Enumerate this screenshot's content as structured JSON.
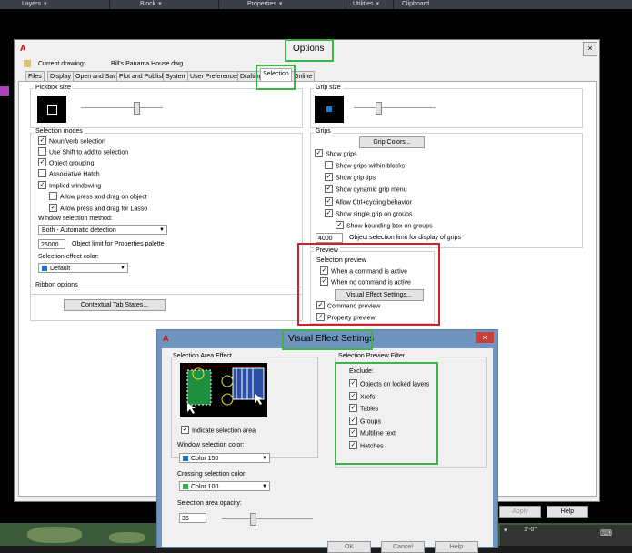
{
  "ribbon": {
    "panels": [
      "Layers",
      "Block",
      "Properties",
      "Utilities",
      "Clipboard"
    ]
  },
  "options": {
    "logo": "A",
    "title": "Options",
    "close_label": "×",
    "current_drawing_label": "Current drawing:",
    "current_drawing_value": "Bill's Panama House.dwg",
    "tabs": [
      "Files",
      "Display",
      "Open and Save",
      "Plot and Publish",
      "System",
      "User Preferences",
      "Drafting",
      "Selection",
      "Online"
    ],
    "active_tab": "Selection",
    "pickbox": {
      "label": "Pickbox size"
    },
    "grip_size": {
      "label": "Grip size"
    },
    "selection_modes": {
      "label": "Selection modes",
      "items": [
        {
          "label": "Noun/verb selection",
          "checked": true
        },
        {
          "label": "Use Shift to add to selection",
          "checked": false
        },
        {
          "label": "Object grouping",
          "checked": true
        },
        {
          "label": "Associative Hatch",
          "checked": false
        },
        {
          "label": "Implied windowing",
          "checked": true
        },
        {
          "label": "Allow press and drag on object",
          "checked": false
        },
        {
          "label": "Allow press and drag for Lasso",
          "checked": true
        }
      ],
      "window_method_label": "Window selection method:",
      "window_method_value": "Both - Automatic detection",
      "object_limit_value": "25000",
      "object_limit_label": "Object limit for Properties palette",
      "effect_color_label": "Selection effect color:",
      "effect_color_value": "Default",
      "effect_color_hex": "#1f6fd8"
    },
    "ribbon_options": {
      "label": "Ribbon options",
      "button": "Contextual Tab States..."
    },
    "grips": {
      "label": "Grips",
      "grip_colors_button": "Grip Colors...",
      "items": [
        {
          "label": "Show grips",
          "checked": true
        },
        {
          "label": "Show grips within blocks",
          "checked": false
        },
        {
          "label": "Show grip tips",
          "checked": true
        },
        {
          "label": "Show dynamic grip menu",
          "checked": true
        },
        {
          "label": "Allow Ctrl+cycling behavior",
          "checked": true
        },
        {
          "label": "Show single grip on groups",
          "checked": true
        },
        {
          "label": "Show bounding box on groups",
          "checked": true
        }
      ],
      "limit_value": "4000",
      "limit_label": "Object selection limit for display of grips"
    },
    "preview": {
      "label": "Preview",
      "selection_preview_label": "Selection preview",
      "when_active": {
        "label": "When a command is active",
        "checked": true
      },
      "when_none": {
        "label": "When no command is active",
        "checked": true
      },
      "ves_button": "Visual Effect Settings...",
      "command_preview": {
        "label": "Command preview",
        "checked": true
      },
      "property_preview": {
        "label": "Property preview",
        "checked": true
      }
    },
    "apply_button": "Apply",
    "help_button": "Help"
  },
  "ves": {
    "title": "Visual Effect Settings",
    "logo": "A",
    "close_label": "×",
    "area_effect_label": "Selection Area Effect",
    "indicate_area": {
      "label": "Indicate selection area",
      "checked": true
    },
    "window_color_label": "Window selection color:",
    "window_color_value": "Color 150",
    "window_color_hex": "#1a6ecc",
    "crossing_color_label": "Crossing selection color:",
    "crossing_color_value": "Color 100",
    "crossing_color_hex": "#2fb34a",
    "opacity_label": "Selection area opacity:",
    "opacity_value": "35",
    "filter_label": "Selection Preview Filter",
    "exclude_label": "Exclude:",
    "filter_items": [
      {
        "label": "Objects on locked layers",
        "checked": true
      },
      {
        "label": "Xrefs",
        "checked": true
      },
      {
        "label": "Tables",
        "checked": true
      },
      {
        "label": "Groups",
        "checked": true
      },
      {
        "label": "Multiline text",
        "checked": true
      },
      {
        "label": "Hatches",
        "checked": true
      }
    ],
    "ok_button": "OK",
    "cancel_button": "Cancel",
    "help_button": "Help"
  },
  "status": {
    "coords": "1'-0\""
  },
  "colors": {
    "highlight_green": "#3cb44b",
    "highlight_red": "#d0202a"
  }
}
